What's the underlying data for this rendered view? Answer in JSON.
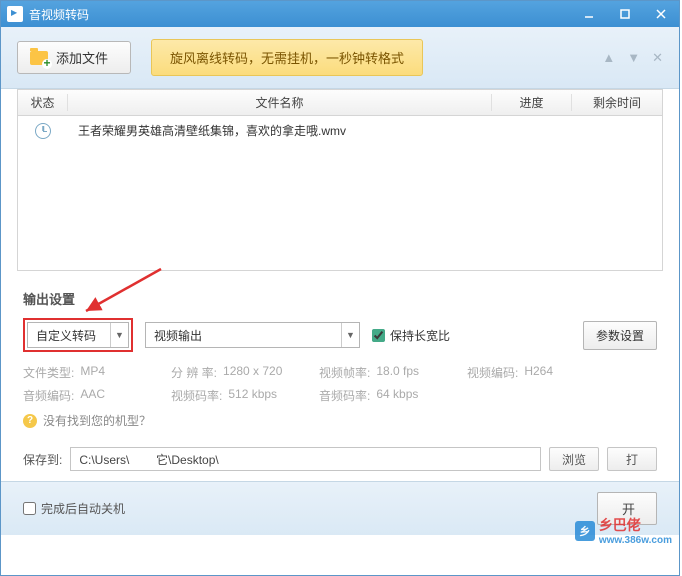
{
  "window": {
    "title": "音视频转码"
  },
  "toolbar": {
    "add_label": "添加文件",
    "banner": "旋风离线转码，无需挂机，一秒钟转格式"
  },
  "table": {
    "headers": {
      "status": "状态",
      "name": "文件名称",
      "progress": "进度",
      "time": "剩余时间"
    },
    "rows": [
      {
        "name": "王者荣耀男英雄高清壁纸集锦，喜欢的拿走哦.wmv"
      }
    ]
  },
  "output": {
    "section_title": "输出设置",
    "preset": "自定义转码",
    "video_out": "视频输出",
    "keep_ratio": "保持长宽比",
    "param_btn": "参数设置",
    "info": {
      "file_type_label": "文件类型:",
      "file_type": "MP4",
      "resolution_label": "分 辨 率:",
      "resolution": "1280 x 720",
      "fps_label": "视频帧率:",
      "fps": "18.0 fps",
      "vcodec_label": "视频编码:",
      "vcodec": "H264",
      "acodec_label": "音频编码:",
      "acodec": "AAC",
      "vbitrate_label": "视频码率:",
      "vbitrate": "512 kbps",
      "abitrate_label": "音频码率:",
      "abitrate": "64 kbps"
    },
    "help": "没有找到您的机型？"
  },
  "save": {
    "label": "保存到:",
    "path": "C:\\Users\\        它\\Desktop\\",
    "browse": "浏览",
    "open": "打"
  },
  "footer": {
    "shutdown": "完成后自动关机",
    "start": "开"
  },
  "watermark": {
    "text": "乡巴佬",
    "url": "www.386w.com"
  }
}
